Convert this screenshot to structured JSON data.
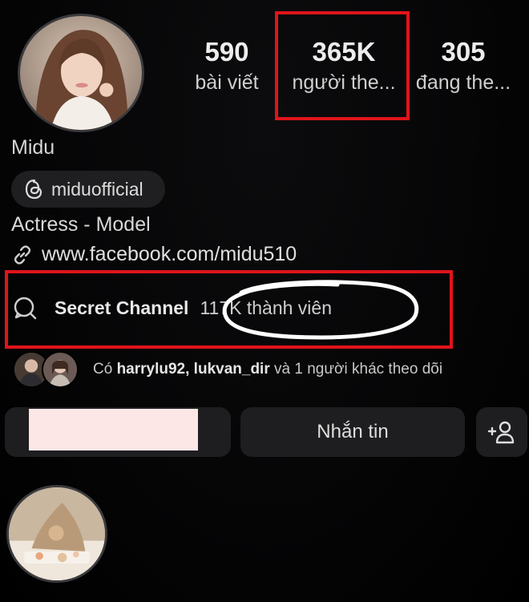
{
  "profile": {
    "display_name": "Midu",
    "threads_handle": "miduofficial",
    "bio": "Actress - Model",
    "link": "www.facebook.com/midu510"
  },
  "stats": {
    "posts": {
      "value": "590",
      "label": "bài viết"
    },
    "followers": {
      "value": "365K",
      "label": "người the..."
    },
    "following": {
      "value": "305",
      "label": "đang the..."
    }
  },
  "channel": {
    "name": "Secret Channel",
    "separator": "",
    "members": "117K thành viên"
  },
  "mutual": {
    "prefix": "Có",
    "users": "harrylu92, lukvan_dir",
    "suffix": "và 1 người khác theo dõi"
  },
  "actions": {
    "message_label": "Nhắn tin"
  },
  "icons": {
    "threads": "threads-icon",
    "link": "link-icon",
    "channel": "channel-chat-icon",
    "add_person": "add-person-icon"
  },
  "colors": {
    "annotation_red": "#e0141b",
    "annotation_circle": "#ffffff",
    "redaction_pink": "#fde6e6",
    "button_bg": "#1e1e20"
  }
}
